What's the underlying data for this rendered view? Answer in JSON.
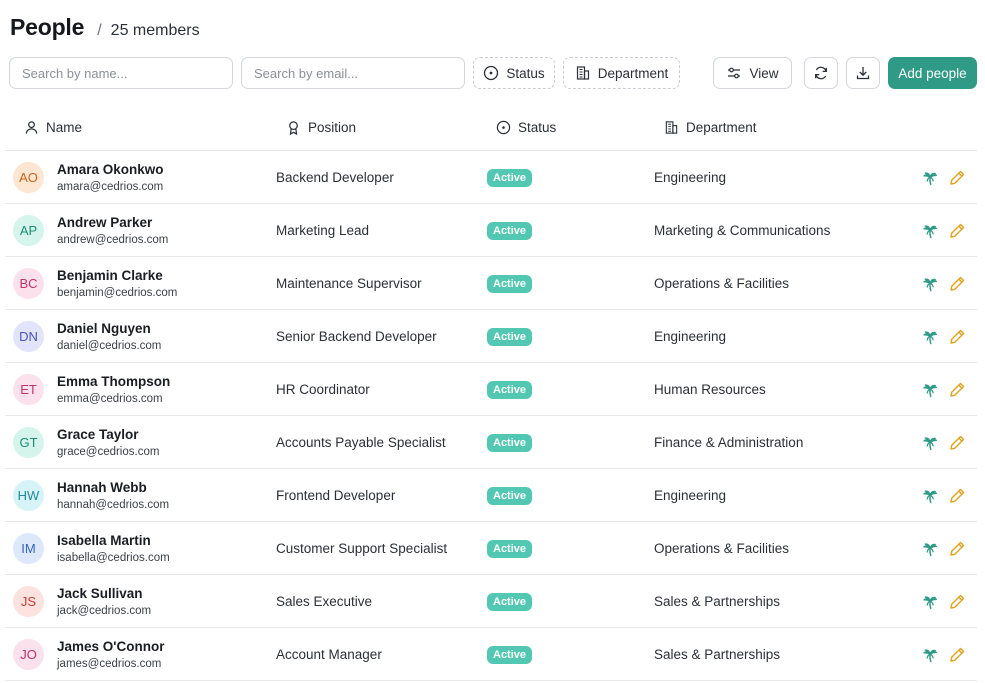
{
  "header": {
    "title": "People",
    "separator": "/",
    "count": "25 members"
  },
  "toolbar": {
    "search_name_placeholder": "Search by name...",
    "search_email_placeholder": "Search by email...",
    "status_label": "Status",
    "department_label": "Department",
    "view_label": "View",
    "add_label": "Add people",
    "primary_color": "#2f9b86"
  },
  "columns": {
    "name": "Name",
    "position": "Position",
    "status": "Status",
    "department": "Department"
  },
  "rows": [
    {
      "initials": "AO",
      "name": "Amara Okonkwo",
      "email": "amara@cedrios.com",
      "position": "Backend Developer",
      "status": "Active",
      "department": "Engineering",
      "avatar_bg": "#fde7d2",
      "avatar_fg": "#c5651c"
    },
    {
      "initials": "AP",
      "name": "Andrew Parker",
      "email": "andrew@cedrios.com",
      "position": "Marketing Lead",
      "status": "Active",
      "department": "Marketing & Communications",
      "avatar_bg": "#d5f5ec",
      "avatar_fg": "#1c8f72"
    },
    {
      "initials": "BC",
      "name": "Benjamin Clarke",
      "email": "benjamin@cedrios.com",
      "position": "Maintenance Supervisor",
      "status": "Active",
      "department": "Operations & Facilities",
      "avatar_bg": "#fbe1ec",
      "avatar_fg": "#c2326a"
    },
    {
      "initials": "DN",
      "name": "Daniel Nguyen",
      "email": "daniel@cedrios.com",
      "position": "Senior Backend Developer",
      "status": "Active",
      "department": "Engineering",
      "avatar_bg": "#e1e4fb",
      "avatar_fg": "#4a52b8"
    },
    {
      "initials": "ET",
      "name": "Emma Thompson",
      "email": "emma@cedrios.com",
      "position": "HR Coordinator",
      "status": "Active",
      "department": "Human Resources",
      "avatar_bg": "#fbe1ec",
      "avatar_fg": "#c2326a"
    },
    {
      "initials": "GT",
      "name": "Grace Taylor",
      "email": "grace@cedrios.com",
      "position": "Accounts Payable Specialist",
      "status": "Active",
      "department": "Finance & Administration",
      "avatar_bg": "#d5f5ec",
      "avatar_fg": "#1c8f72"
    },
    {
      "initials": "HW",
      "name": "Hannah Webb",
      "email": "hannah@cedrios.com",
      "position": "Frontend Developer",
      "status": "Active",
      "department": "Engineering",
      "avatar_bg": "#d6f3f8",
      "avatar_fg": "#1f8aa0"
    },
    {
      "initials": "IM",
      "name": "Isabella Martin",
      "email": "isabella@cedrios.com",
      "position": "Customer Support Specialist",
      "status": "Active",
      "department": "Operations & Facilities",
      "avatar_bg": "#dde8fb",
      "avatar_fg": "#3565bd"
    },
    {
      "initials": "JS",
      "name": "Jack Sullivan",
      "email": "jack@cedrios.com",
      "position": "Sales Executive",
      "status": "Active",
      "department": "Sales & Partnerships",
      "avatar_bg": "#fde2e0",
      "avatar_fg": "#c23c30"
    },
    {
      "initials": "JO",
      "name": "James O'Connor",
      "email": "james@cedrios.com",
      "position": "Account Manager",
      "status": "Active",
      "department": "Sales & Partnerships",
      "avatar_bg": "#fbe1ec",
      "avatar_fg": "#c2326a"
    }
  ],
  "icons": {
    "action_primary": "palm-tree-icon",
    "action_secondary": "pencil-icon",
    "action_primary_color": "#2f9b86",
    "action_secondary_color": "#e0a21f"
  }
}
